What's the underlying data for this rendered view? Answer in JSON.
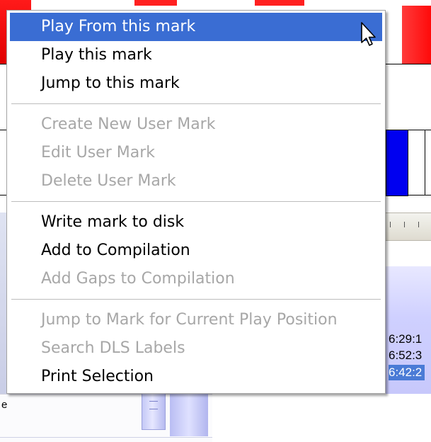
{
  "context_menu": {
    "groups": [
      [
        {
          "label": "Play From this mark",
          "enabled": true,
          "highlighted": true
        },
        {
          "label": "Play this mark",
          "enabled": true
        },
        {
          "label": "Jump to this mark",
          "enabled": true
        }
      ],
      [
        {
          "label": "Create New User Mark",
          "enabled": false
        },
        {
          "label": "Edit User Mark",
          "enabled": false
        },
        {
          "label": "Delete User Mark",
          "enabled": false
        }
      ],
      [
        {
          "label": "Write mark to disk",
          "enabled": true
        },
        {
          "label": "Add to Compilation",
          "enabled": true
        },
        {
          "label": "Add Gaps to Compilation",
          "enabled": false
        }
      ],
      [
        {
          "label": "Jump to Mark for Current Play Position",
          "enabled": false
        },
        {
          "label": "Search DLS Labels",
          "enabled": false
        },
        {
          "label": "Print Selection",
          "enabled": true
        }
      ]
    ]
  },
  "background": {
    "time_labels": [
      "6:29:1",
      "6:52:3",
      "6:42:2"
    ],
    "selected_time_index": 2,
    "bottom_left_letter": "e"
  },
  "colors": {
    "highlight": "#3a6dd3",
    "disabled_text": "#a7a7a7",
    "marker_red": "#ff1a1a",
    "marker_blue": "#0000f0"
  },
  "icons": {
    "cursor": "arrow-pointer-icon"
  }
}
